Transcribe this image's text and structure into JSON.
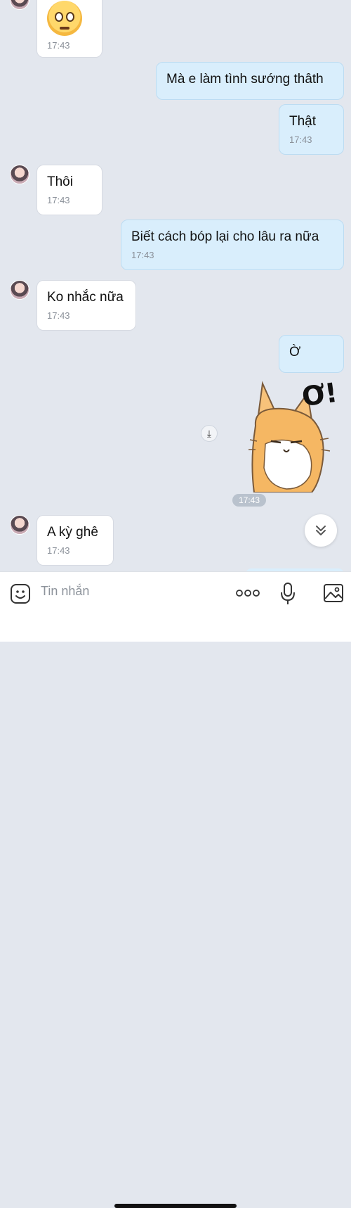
{
  "messages": [
    {
      "side": "in",
      "type": "emoji",
      "emoji": "worried-face",
      "time": "17:43"
    },
    {
      "side": "out",
      "text": "Mà e làm tình sướng thâth"
    },
    {
      "side": "out",
      "text": "Thật",
      "time": "17:43"
    },
    {
      "side": "in",
      "text": "Thôi",
      "time": "17:43"
    },
    {
      "side": "out",
      "text": "Biết cách bóp lại cho lâu ra nữa",
      "time": "17:43"
    },
    {
      "side": "in",
      "text": "Ko nhắc nữa",
      "time": "17:43"
    },
    {
      "side": "out",
      "text": "Ờ"
    },
    {
      "side": "out",
      "type": "sticker",
      "sticker": "fox-cat-sticker",
      "sticker_text": "Ơ!",
      "time": "17:43"
    },
    {
      "side": "in",
      "text": "A kỳ ghê",
      "time": "17:43"
    }
  ],
  "composer": {
    "placeholder": "Tin nhắn",
    "icons": [
      "sticker-icon",
      "more-options-icon",
      "microphone-icon",
      "image-icon"
    ]
  },
  "colors": {
    "background": "#e3e7ee",
    "incoming_bubble": "#ffffff",
    "outgoing_bubble": "#d9eefc",
    "time_text": "#8a9099"
  }
}
